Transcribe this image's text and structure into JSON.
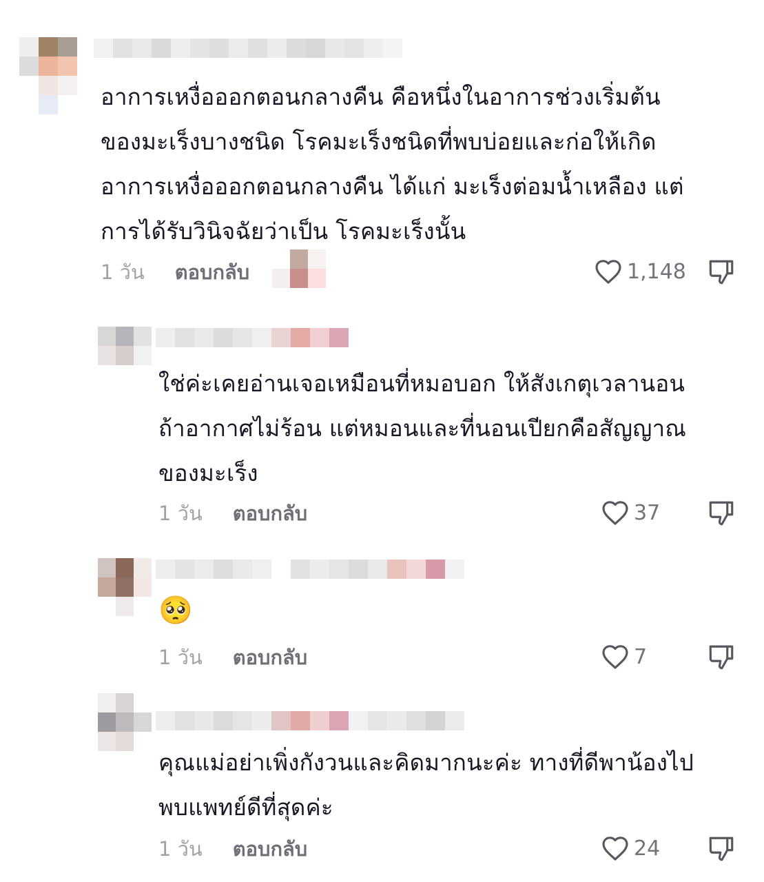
{
  "comments": [
    {
      "lines": [
        "อาการเหงื่อออกตอนกลางคืน คือหนึ่งในอาการช่วงเริ่มต้น",
        "ของมะเร็งบางชนิด โรคมะเร็งชนิดที่พบบ่อยและก่อให้เกิด",
        "อาการเหงื่อออกตอนกลางคืน ได้แก่ มะเร็งต่อมน้ำเหลือง แต่",
        "การได้รับวินิจฉัยว่าเป็น โรคมะเร็งนั้น"
      ],
      "time": "1 วัน",
      "reply": "ตอบกลับ",
      "likes": "1,148"
    },
    {
      "lines": [
        "ใช่ค่ะเคยอ่านเจอเหมือนที่หมอบอก ให้สังเกตุเวลานอน",
        "ถ้าอากาศไม่ร้อน แต่หมอนและที่นอนเปียกคือสัญญาณ",
        "ของมะเร็ง"
      ],
      "time": "1 วัน",
      "reply": "ตอบกลับ",
      "likes": "37"
    },
    {
      "emoji": "🥺",
      "time": "1 วัน",
      "reply": "ตอบกลับ",
      "likes": "7"
    },
    {
      "lines": [
        "คุณแม่อย่าเพิ่งกังวนและคิดมากนะค่ะ ทางที่ดีพาน้องไป",
        "พบแพทย์ดีที่สุดค่ะ"
      ],
      "time": "1 วัน",
      "reply": "ตอบกลับ",
      "likes": "24"
    }
  ],
  "icons": {
    "like": "heart-outline-icon",
    "dislike": "thumbs-down-outline-icon"
  },
  "colors": {
    "text": "#161823",
    "muted": "#a1a2a7",
    "reply": "#6f7077",
    "icon": "#57585f"
  }
}
